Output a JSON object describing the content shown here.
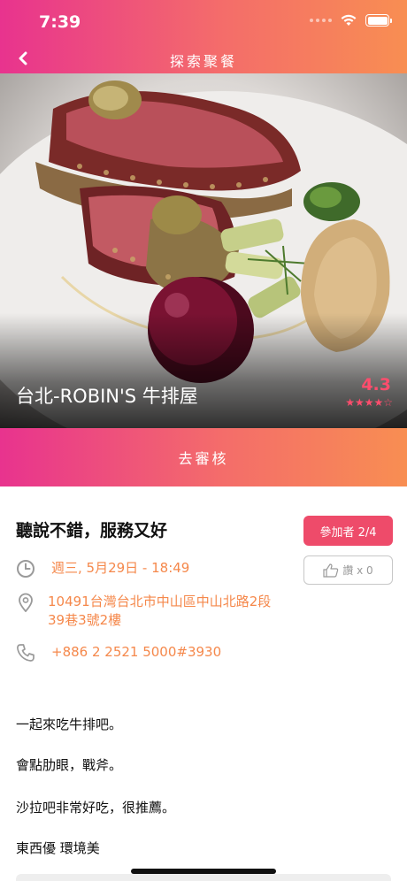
{
  "status_bar": {
    "time": "7:39"
  },
  "nav": {
    "title": "探索聚餐"
  },
  "restaurant": {
    "name": "台北-ROBIN'S 牛排屋",
    "rating": "4.3",
    "stars": "★★★★☆"
  },
  "review_bar": {
    "label": "去審核"
  },
  "event": {
    "title": "聽說不錯，服務又好",
    "join_label": "參加者 2/4",
    "like_label": "讚 x 0",
    "datetime": "週三, 5月29日 - 18:49",
    "address_line1": "10491台灣台北市中山區中山北路2段",
    "address_line2": "39巷3號2樓",
    "phone": "+886 2 2521 5000#3930"
  },
  "description": [
    "一起來吃牛排吧。",
    "會點肋眼，戰斧。",
    "沙拉吧非常好吃，很推薦。",
    "東西優 環境美"
  ],
  "colors": {
    "accent_start": "#e8338e",
    "accent_end": "#f88e52",
    "info_text": "#f5884b",
    "join_button": "#ee4b6a"
  },
  "icons": [
    "back-arrow-icon",
    "wifi-icon",
    "battery-icon",
    "clock-icon",
    "location-pin-icon",
    "phone-icon",
    "thumbs-up-icon"
  ]
}
